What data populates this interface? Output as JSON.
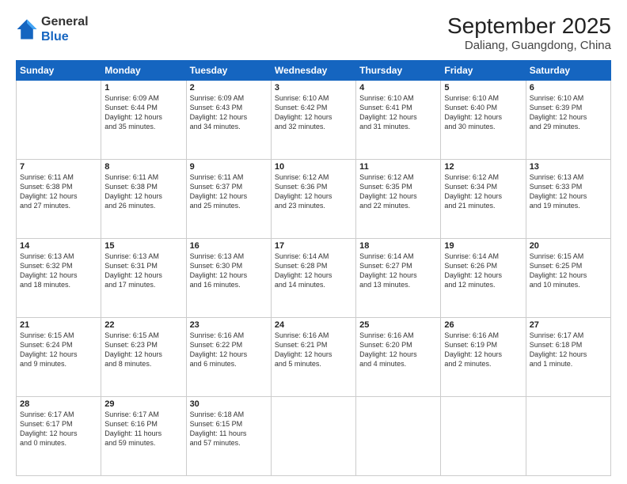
{
  "header": {
    "logo_line1": "General",
    "logo_line2": "Blue",
    "month": "September 2025",
    "location": "Daliang, Guangdong, China"
  },
  "days_of_week": [
    "Sunday",
    "Monday",
    "Tuesday",
    "Wednesday",
    "Thursday",
    "Friday",
    "Saturday"
  ],
  "weeks": [
    [
      {
        "day": "",
        "info": ""
      },
      {
        "day": "1",
        "info": "Sunrise: 6:09 AM\nSunset: 6:44 PM\nDaylight: 12 hours\nand 35 minutes."
      },
      {
        "day": "2",
        "info": "Sunrise: 6:09 AM\nSunset: 6:43 PM\nDaylight: 12 hours\nand 34 minutes."
      },
      {
        "day": "3",
        "info": "Sunrise: 6:10 AM\nSunset: 6:42 PM\nDaylight: 12 hours\nand 32 minutes."
      },
      {
        "day": "4",
        "info": "Sunrise: 6:10 AM\nSunset: 6:41 PM\nDaylight: 12 hours\nand 31 minutes."
      },
      {
        "day": "5",
        "info": "Sunrise: 6:10 AM\nSunset: 6:40 PM\nDaylight: 12 hours\nand 30 minutes."
      },
      {
        "day": "6",
        "info": "Sunrise: 6:10 AM\nSunset: 6:39 PM\nDaylight: 12 hours\nand 29 minutes."
      }
    ],
    [
      {
        "day": "7",
        "info": "Sunrise: 6:11 AM\nSunset: 6:38 PM\nDaylight: 12 hours\nand 27 minutes."
      },
      {
        "day": "8",
        "info": "Sunrise: 6:11 AM\nSunset: 6:38 PM\nDaylight: 12 hours\nand 26 minutes."
      },
      {
        "day": "9",
        "info": "Sunrise: 6:11 AM\nSunset: 6:37 PM\nDaylight: 12 hours\nand 25 minutes."
      },
      {
        "day": "10",
        "info": "Sunrise: 6:12 AM\nSunset: 6:36 PM\nDaylight: 12 hours\nand 23 minutes."
      },
      {
        "day": "11",
        "info": "Sunrise: 6:12 AM\nSunset: 6:35 PM\nDaylight: 12 hours\nand 22 minutes."
      },
      {
        "day": "12",
        "info": "Sunrise: 6:12 AM\nSunset: 6:34 PM\nDaylight: 12 hours\nand 21 minutes."
      },
      {
        "day": "13",
        "info": "Sunrise: 6:13 AM\nSunset: 6:33 PM\nDaylight: 12 hours\nand 19 minutes."
      }
    ],
    [
      {
        "day": "14",
        "info": "Sunrise: 6:13 AM\nSunset: 6:32 PM\nDaylight: 12 hours\nand 18 minutes."
      },
      {
        "day": "15",
        "info": "Sunrise: 6:13 AM\nSunset: 6:31 PM\nDaylight: 12 hours\nand 17 minutes."
      },
      {
        "day": "16",
        "info": "Sunrise: 6:13 AM\nSunset: 6:30 PM\nDaylight: 12 hours\nand 16 minutes."
      },
      {
        "day": "17",
        "info": "Sunrise: 6:14 AM\nSunset: 6:28 PM\nDaylight: 12 hours\nand 14 minutes."
      },
      {
        "day": "18",
        "info": "Sunrise: 6:14 AM\nSunset: 6:27 PM\nDaylight: 12 hours\nand 13 minutes."
      },
      {
        "day": "19",
        "info": "Sunrise: 6:14 AM\nSunset: 6:26 PM\nDaylight: 12 hours\nand 12 minutes."
      },
      {
        "day": "20",
        "info": "Sunrise: 6:15 AM\nSunset: 6:25 PM\nDaylight: 12 hours\nand 10 minutes."
      }
    ],
    [
      {
        "day": "21",
        "info": "Sunrise: 6:15 AM\nSunset: 6:24 PM\nDaylight: 12 hours\nand 9 minutes."
      },
      {
        "day": "22",
        "info": "Sunrise: 6:15 AM\nSunset: 6:23 PM\nDaylight: 12 hours\nand 8 minutes."
      },
      {
        "day": "23",
        "info": "Sunrise: 6:16 AM\nSunset: 6:22 PM\nDaylight: 12 hours\nand 6 minutes."
      },
      {
        "day": "24",
        "info": "Sunrise: 6:16 AM\nSunset: 6:21 PM\nDaylight: 12 hours\nand 5 minutes."
      },
      {
        "day": "25",
        "info": "Sunrise: 6:16 AM\nSunset: 6:20 PM\nDaylight: 12 hours\nand 4 minutes."
      },
      {
        "day": "26",
        "info": "Sunrise: 6:16 AM\nSunset: 6:19 PM\nDaylight: 12 hours\nand 2 minutes."
      },
      {
        "day": "27",
        "info": "Sunrise: 6:17 AM\nSunset: 6:18 PM\nDaylight: 12 hours\nand 1 minute."
      }
    ],
    [
      {
        "day": "28",
        "info": "Sunrise: 6:17 AM\nSunset: 6:17 PM\nDaylight: 12 hours\nand 0 minutes."
      },
      {
        "day": "29",
        "info": "Sunrise: 6:17 AM\nSunset: 6:16 PM\nDaylight: 11 hours\nand 59 minutes."
      },
      {
        "day": "30",
        "info": "Sunrise: 6:18 AM\nSunset: 6:15 PM\nDaylight: 11 hours\nand 57 minutes."
      },
      {
        "day": "",
        "info": ""
      },
      {
        "day": "",
        "info": ""
      },
      {
        "day": "",
        "info": ""
      },
      {
        "day": "",
        "info": ""
      }
    ]
  ]
}
